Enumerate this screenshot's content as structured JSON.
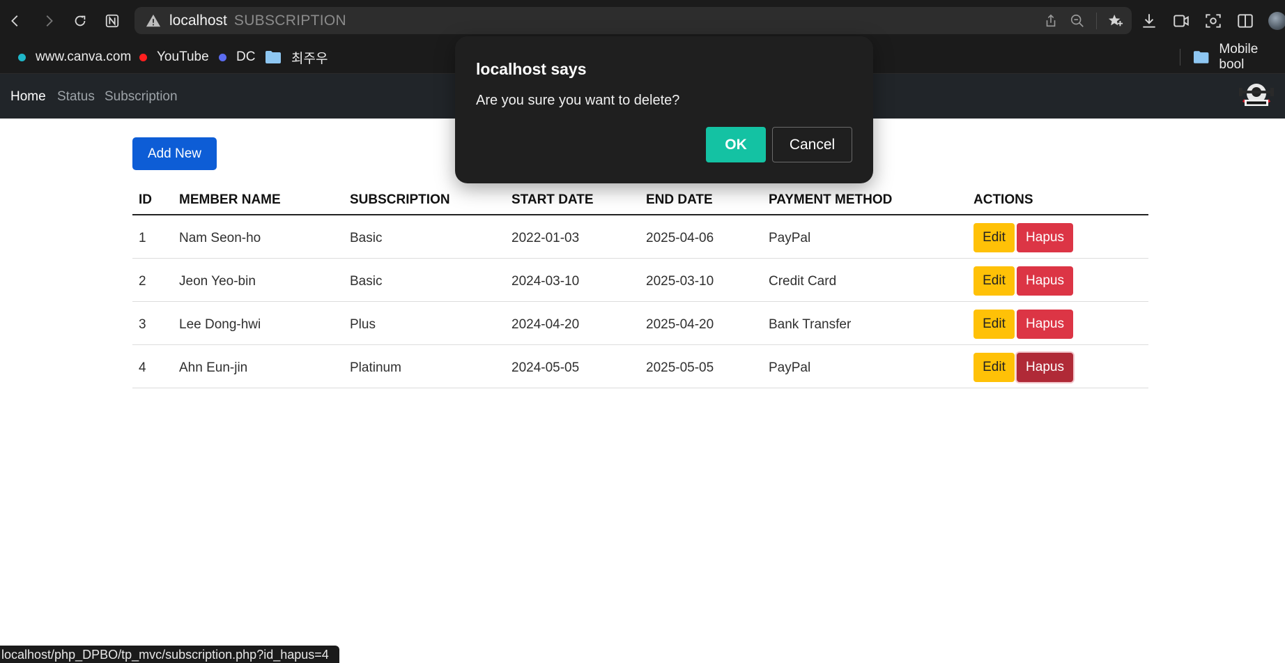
{
  "browser": {
    "address_host": "localhost",
    "address_path": "SUBSCRIPTION",
    "bookmarks": [
      {
        "label": "www.canva.com",
        "dot_color": "#1fb7c9"
      },
      {
        "label": "YouTube",
        "dot_color": "#ff1f1f"
      },
      {
        "label": "DC",
        "dot_color": "#5b6cf0"
      },
      {
        "label": "최주우",
        "icon": "folder-icon"
      },
      {
        "label": "Mobile bool",
        "icon": "folder-icon"
      }
    ],
    "status_url": "localhost/php_DPBO/tp_mvc/subscription.php?id_hapus=4"
  },
  "site_nav": {
    "links": [
      "Home",
      "Status",
      "Subscription"
    ],
    "active": "Home"
  },
  "content": {
    "add_button": "Add New",
    "table": {
      "headers": [
        "ID",
        "MEMBER NAME",
        "SUBSCRIPTION",
        "START DATE",
        "END DATE",
        "PAYMENT METHOD",
        "ACTIONS"
      ],
      "rows": [
        {
          "id": "1",
          "name": "Nam Seon-ho",
          "subscription": "Basic",
          "start": "2022-01-03",
          "end": "2025-04-06",
          "payment": "PayPal"
        },
        {
          "id": "2",
          "name": "Jeon Yeo-bin",
          "subscription": "Basic",
          "start": "2024-03-10",
          "end": "2025-03-10",
          "payment": "Credit Card"
        },
        {
          "id": "3",
          "name": "Lee Dong-hwi",
          "subscription": "Plus",
          "start": "2024-04-20",
          "end": "2025-04-20",
          "payment": "Bank Transfer"
        },
        {
          "id": "4",
          "name": "Ahn Eun-jin",
          "subscription": "Platinum",
          "start": "2024-05-05",
          "end": "2025-05-05",
          "payment": "PayPal"
        }
      ],
      "edit_label": "Edit",
      "delete_label": "Hapus"
    }
  },
  "dialog": {
    "title": "localhost says",
    "message": "Are you sure you want to delete?",
    "ok_label": "OK",
    "cancel_label": "Cancel"
  },
  "colors": {
    "primary": "#0d5dd6",
    "warning": "#ffc107",
    "danger": "#dc3545",
    "dialog_ok": "#14c2a3"
  }
}
